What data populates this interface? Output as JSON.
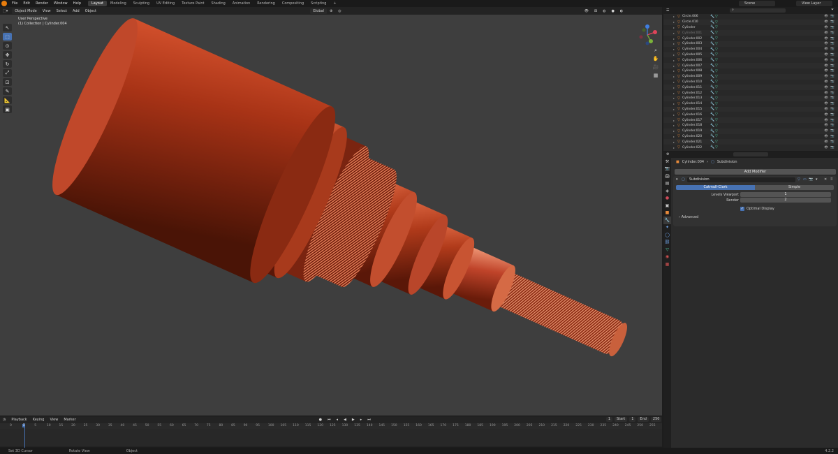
{
  "menu": [
    "File",
    "Edit",
    "Render",
    "Window",
    "Help"
  ],
  "workspaces": [
    {
      "label": "Layout",
      "active": true
    },
    {
      "label": "Modeling"
    },
    {
      "label": "Sculpting"
    },
    {
      "label": "UV Editing"
    },
    {
      "label": "Texture Paint"
    },
    {
      "label": "Shading"
    },
    {
      "label": "Animation"
    },
    {
      "label": "Rendering"
    },
    {
      "label": "Compositing"
    },
    {
      "label": "Scripting"
    },
    {
      "label": "+"
    }
  ],
  "scene": "Scene",
  "view_layer": "View Layer",
  "viewport": {
    "mode": "Object Mode",
    "menus": [
      "View",
      "Select",
      "Add",
      "Object"
    ],
    "transform": "Global",
    "info_line1": "User Perspective",
    "info_line2": "(1) Collection | Cylinder.004"
  },
  "outliner": {
    "items": [
      {
        "name": "Circle.006",
        "dim": false
      },
      {
        "name": "Circle.010",
        "dim": false
      },
      {
        "name": "Cylinder",
        "dim": false
      },
      {
        "name": "Cylinder.001",
        "dim": true
      },
      {
        "name": "Cylinder.002",
        "dim": false
      },
      {
        "name": "Cylinder.003",
        "dim": false
      },
      {
        "name": "Cylinder.004",
        "dim": false
      },
      {
        "name": "Cylinder.005",
        "dim": false
      },
      {
        "name": "Cylinder.006",
        "dim": false
      },
      {
        "name": "Cylinder.007",
        "dim": false
      },
      {
        "name": "Cylinder.008",
        "dim": false
      },
      {
        "name": "Cylinder.009",
        "dim": false
      },
      {
        "name": "Cylinder.010",
        "dim": false
      },
      {
        "name": "Cylinder.011",
        "dim": false
      },
      {
        "name": "Cylinder.012",
        "dim": false
      },
      {
        "name": "Cylinder.013",
        "dim": false
      },
      {
        "name": "Cylinder.014",
        "dim": false
      },
      {
        "name": "Cylinder.015",
        "dim": false
      },
      {
        "name": "Cylinder.016",
        "dim": false
      },
      {
        "name": "Cylinder.017",
        "dim": false
      },
      {
        "name": "Cylinder.018",
        "dim": false
      },
      {
        "name": "Cylinder.019",
        "dim": false
      },
      {
        "name": "Cylinder.020",
        "dim": false
      },
      {
        "name": "Cylinder.021",
        "dim": false
      },
      {
        "name": "Cylinder.022",
        "dim": false
      }
    ]
  },
  "properties": {
    "object": "Cylinder.004",
    "modifier_crumb": "Subdivision",
    "add_modifier": "Add Modifier",
    "modifier_name": "Subdivision",
    "mode_a": "Catmull-Clark",
    "mode_b": "Simple",
    "levels_label": "Levels Viewport",
    "levels_value": "1",
    "render_label": "Render",
    "render_value": "2",
    "optimal_label": "Optimal Display",
    "advanced_label": "Advanced"
  },
  "timeline": {
    "menus": [
      "Playback",
      "Keying",
      "View",
      "Marker"
    ],
    "current_frame": "1",
    "start_label": "Start",
    "start": "1",
    "end_label": "End",
    "end": "250",
    "ticks": [
      "0",
      "1",
      "5",
      "10",
      "15",
      "20",
      "25",
      "30",
      "35",
      "40",
      "45",
      "50",
      "55",
      "60",
      "65",
      "70",
      "75",
      "80",
      "85",
      "90",
      "95",
      "100",
      "105",
      "110",
      "115",
      "120",
      "125",
      "130",
      "135",
      "140",
      "145",
      "150",
      "155",
      "160",
      "165",
      "170",
      "175",
      "180",
      "185",
      "190",
      "195",
      "200",
      "205",
      "210",
      "215",
      "220",
      "225",
      "230",
      "235",
      "240",
      "245",
      "250",
      "255"
    ]
  },
  "status": {
    "item1": "Set 3D Cursor",
    "item2": "Rotate View",
    "item3": "Object",
    "version": "4.2.2"
  },
  "colors": {
    "accent": "#4772b3",
    "cable_copper": "#b83a1d"
  }
}
